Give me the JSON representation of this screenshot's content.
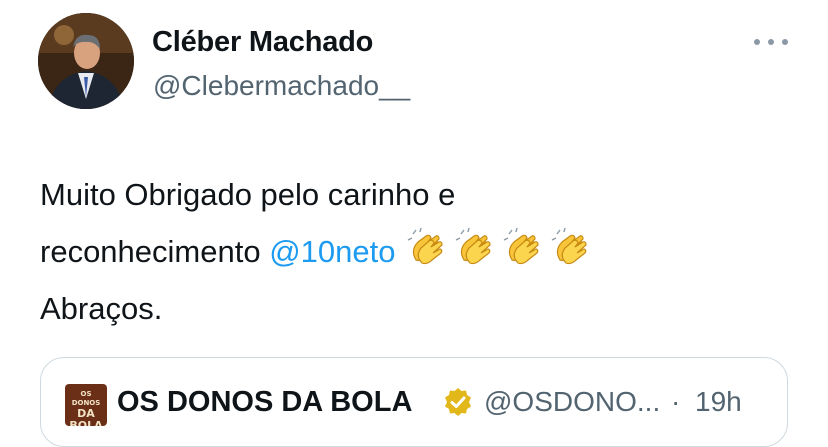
{
  "author": {
    "name": "Cléber Machado",
    "handle": "@Clebermachado__"
  },
  "tweet": {
    "line1": "Muito Obrigado pelo carinho e",
    "line2_prefix": "reconhecimento",
    "mention": "@10neto",
    "emoji": [
      "clapping-hands",
      "clapping-hands",
      "clapping-hands",
      "clapping-hands"
    ],
    "line3": "Abraços."
  },
  "quoted": {
    "avatar_text_top": "OS DONOS",
    "avatar_text_bottom": "DA BOLA",
    "name": "OS DONOS DA BOLA",
    "verified_icon": "gold-verified-badge",
    "handle": "@OSDONO...",
    "separator": "·",
    "time": "19h"
  },
  "colors": {
    "link": "#1d9bf0",
    "secondary_text": "#536471",
    "primary_text": "#0f1419",
    "border": "#cfd9de",
    "verified_gold": "#e2b719"
  }
}
